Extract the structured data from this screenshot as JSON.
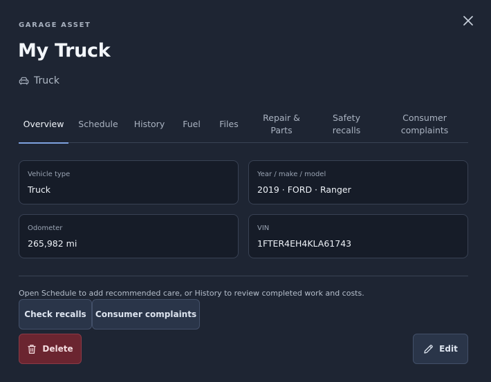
{
  "header": {
    "eyebrow": "GARAGE ASSET",
    "title": "My Truck",
    "subtitle": "Truck",
    "subtitle_icon": "car-icon",
    "close_icon": "close-icon"
  },
  "tabs": [
    {
      "label": "Overview",
      "active": true
    },
    {
      "label": "Schedule",
      "active": false
    },
    {
      "label": "History",
      "active": false
    },
    {
      "label": "Fuel",
      "active": false
    },
    {
      "label": "Files",
      "active": false
    },
    {
      "label": "Repair & Parts",
      "active": false
    },
    {
      "label": "Safety recalls",
      "active": false
    },
    {
      "label": "Consumer complaints",
      "active": false
    }
  ],
  "details": {
    "vehicle_type": {
      "label": "Vehicle type",
      "value": "Truck"
    },
    "year_make_model": {
      "label": "Year / make / model",
      "value": "2019 · FORD · Ranger"
    },
    "odometer": {
      "label": "Odometer",
      "value": "265,982 mi"
    },
    "vin": {
      "label": "VIN",
      "value": "1FTER4EH4KLA61743"
    }
  },
  "hint": "Open Schedule to add recommended care, or History to review completed work and costs.",
  "actions": {
    "check_recalls": "Check recalls",
    "consumer_complaints": "Consumer complaints",
    "delete": "Delete",
    "delete_icon": "trash-icon",
    "edit": "Edit",
    "edit_icon": "pencil-icon"
  },
  "colors": {
    "background": "#1e2533",
    "card": "#161c28",
    "accent": "#7ea2e0",
    "danger": "#6b2530"
  }
}
